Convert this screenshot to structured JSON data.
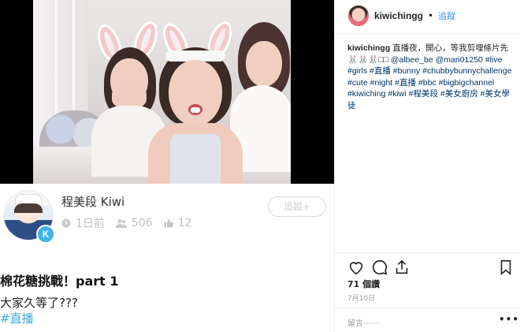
{
  "kiwi_app": {
    "channel_name": "程美段 Kiwi",
    "avatar_badge": "K",
    "time_ago": "1日前",
    "viewers": "506",
    "likes": "12",
    "follow_label": "追蹤+",
    "post_title": "棉花糖挑戰！part 1",
    "post_desc": "大家久等了???",
    "post_tag": "#直播"
  },
  "instagram": {
    "username": "kiwichingg",
    "dot": "•",
    "follow_label": "追蹤",
    "caption_user": "kiwichingg",
    "caption_text": "直播夜，開心，等我剪埋條片先🐰🐰🐰□□",
    "caption_tags": [
      "@albee_be",
      "@mari01250",
      "#live",
      "#girls",
      "#直播",
      "#bunny",
      "#chubbybunnychallenge",
      "#cute",
      "#night",
      "#直播",
      "#bbc",
      "#bigbigchannel",
      "#kiwiching",
      "#kiwi",
      "#程美段",
      "#美女廚房",
      "#美女學徒"
    ],
    "likes_text": "71 個讚",
    "date_text": "7月10日",
    "comment_placeholder": "留言⋯⋯",
    "more_label": "•••"
  },
  "icons": {
    "clock": "clock-icon",
    "people": "people-icon",
    "thumb": "thumbs-up-icon",
    "heart": "heart-icon",
    "comment": "comment-icon",
    "share": "share-icon",
    "bookmark": "bookmark-icon"
  },
  "colors": {
    "kiwi_blue": "#3fb4e6",
    "ig_blue": "#3897f0",
    "hashtag": "#003569"
  }
}
